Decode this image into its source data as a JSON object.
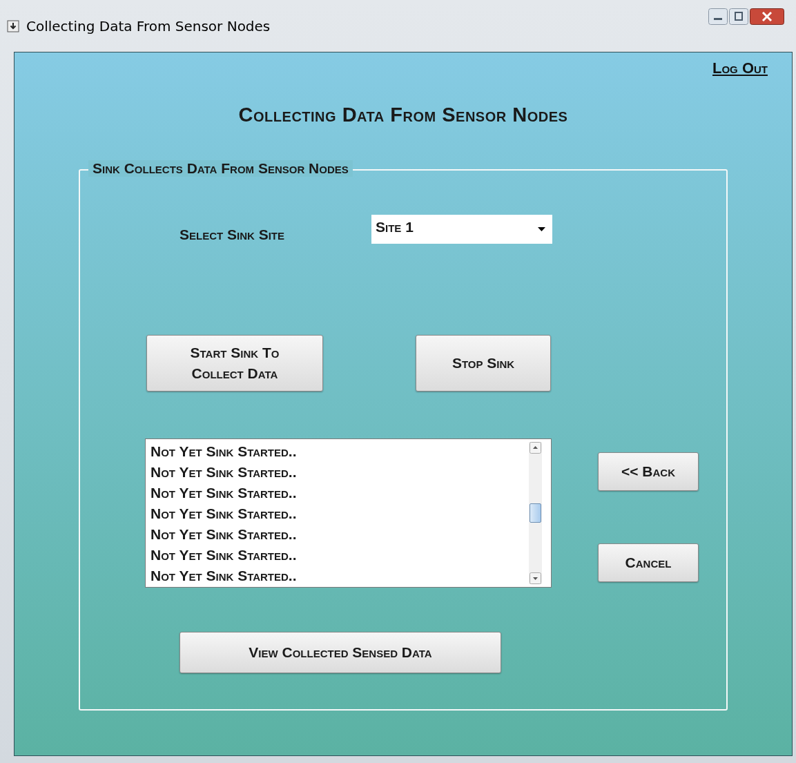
{
  "window": {
    "title": "Collecting Data From Sensor Nodes"
  },
  "log_out": "Log Out",
  "heading": "Collecting Data From Sensor Nodes",
  "group": {
    "title": "Sink Collects Data From Sensor Nodes",
    "site_label": "Select Sink Site",
    "site_select": {
      "value": "Site 1"
    },
    "start_button": [
      "Start Sink To",
      "Collect Data"
    ],
    "stop_button": "Stop Sink",
    "log_list": [
      "Not Yet Sink Started..",
      "Not Yet Sink Started..",
      "Not Yet Sink Started..",
      "Not Yet Sink Started..",
      "Not Yet Sink Started..",
      "Not Yet Sink Started..",
      "Not Yet Sink Started.."
    ],
    "back_button": "<< Back",
    "cancel_button": "Cancel",
    "view_button": "View Collected Sensed Data"
  }
}
